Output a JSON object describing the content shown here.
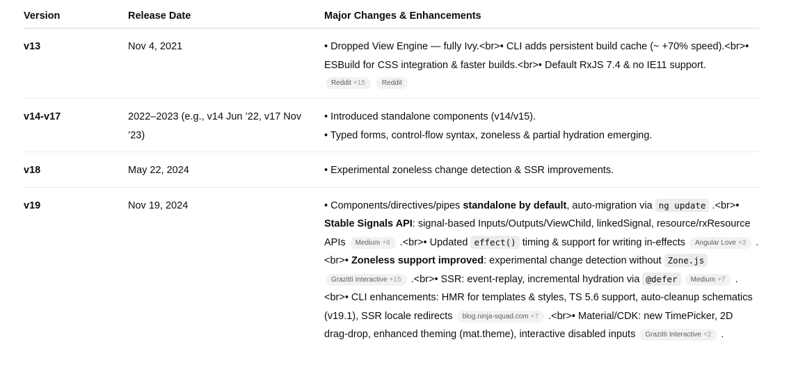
{
  "headers": {
    "version": "Version",
    "release_date": "Release Date",
    "changes": "Major Changes & Enhancements"
  },
  "rows": [
    {
      "version": "v13",
      "date": "Nov 4, 2021",
      "text1": "• Dropped View Engine — fully Ivy.<br>• CLI adds persistent build cache (~ +70% speed).<br>• ESBuild for CSS integration & faster builds.<br>• Default RxJS 7.4 & no IE11 support.",
      "chips": [
        {
          "label": "Reddit",
          "plus": "+15"
        },
        {
          "label": "Reddit",
          "plus": ""
        }
      ]
    },
    {
      "version": "v14-v17",
      "date": "2022–2023 (e.g., v14 Jun ’22, v17 Nov ’23)",
      "line1": "• Introduced standalone components (v14/v15).",
      "line2": "• Typed forms, control-flow syntax, zoneless & partial hydration emerging."
    },
    {
      "version": "v18",
      "date": "May 22, 2024",
      "line1": "• Experimental zoneless change detection & SSR improvements."
    },
    {
      "version": "v19",
      "date": "Nov 19, 2024",
      "s1": "• Components/directives/pipes ",
      "b1": "standalone by default",
      "s2": ", auto-migration via ",
      "code1": "ng update",
      "s3": " .<br>• ",
      "b2": "Stable Signals API",
      "s4": ": signal-based Inputs/Outputs/ViewChild, linkedSignal, resource/rxResource APIs ",
      "chip1": {
        "label": "Medium",
        "plus": "+8"
      },
      "s5": " .<br>• Updated ",
      "code2": "effect()",
      "s6": " timing & support for writing in-effects ",
      "chip2": {
        "label": "Angular Love",
        "plus": "+3"
      },
      "s7": " .<br>• ",
      "b3": "Zoneless support improved",
      "s8": ": experimental change detection without ",
      "code3": "Zone.js",
      "chip3": {
        "label": "Grazitti Interactive",
        "plus": "+15"
      },
      "s9": " .<br>• SSR: event-replay, incremental hydration via ",
      "code4": "@defer",
      "chip4": {
        "label": "Medium",
        "plus": "+7"
      },
      "s10": " .<br>• CLI enhancements: HMR for templates & styles, TS 5.6 support, auto-cleanup schematics (v19.1), SSR locale redirects ",
      "chip5": {
        "label": "blog.ninja-squad.com",
        "plus": "+7"
      },
      "s11": " .<br>• Material/CDK: new TimePicker, 2D drag-drop, enhanced theming (mat.theme), interactive disabled inputs ",
      "chip6": {
        "label": "Grazitti Interactive",
        "plus": "+2"
      },
      "s12": " ."
    }
  ]
}
